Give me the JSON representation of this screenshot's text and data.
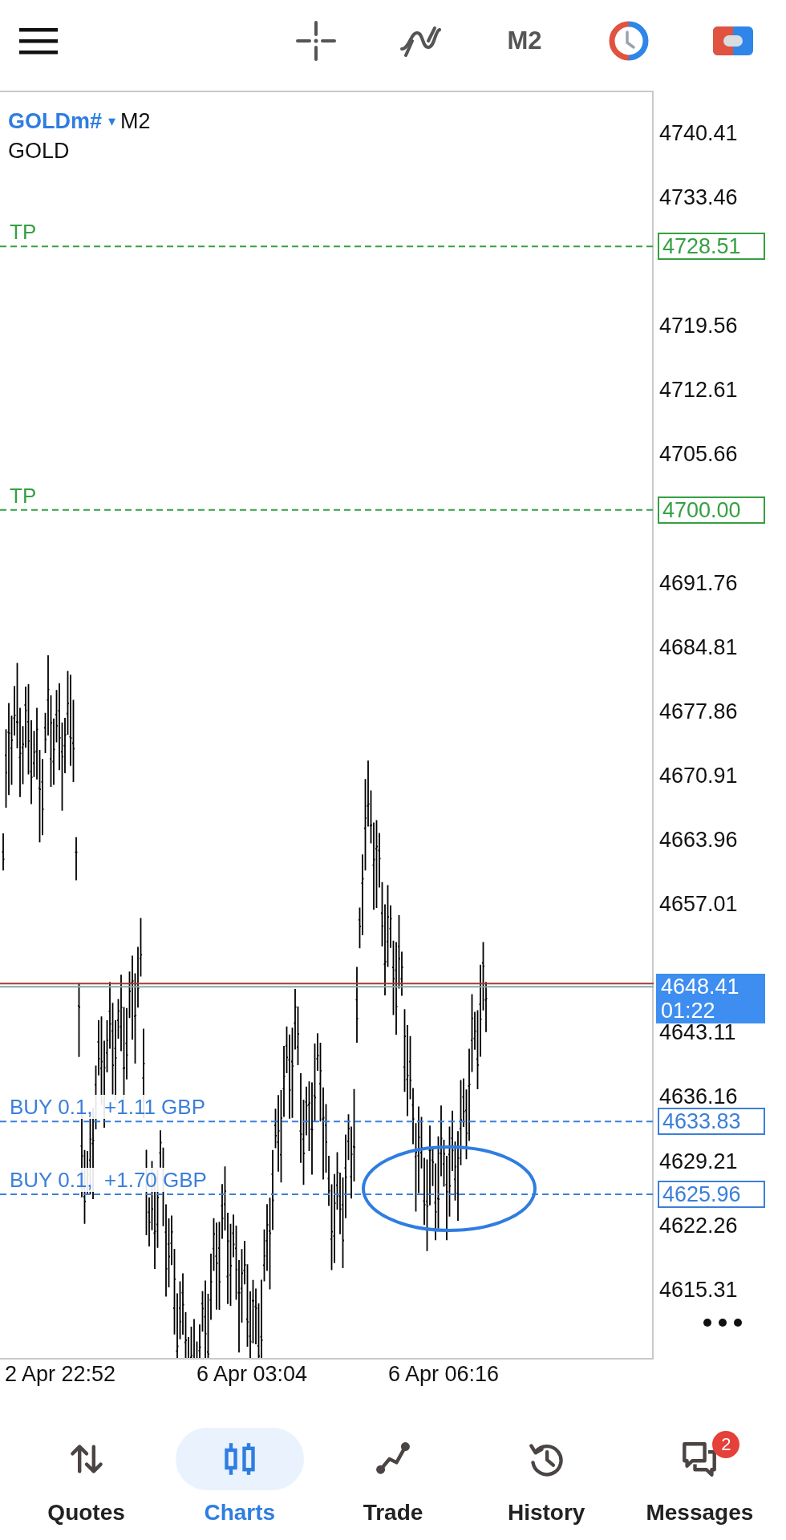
{
  "toolbar": {
    "timeframe": "M2"
  },
  "chart": {
    "symbol": "GOLDm#",
    "dropdown": "▾",
    "timeframe": "M2",
    "description": "GOLD",
    "levels": [
      {
        "kind": "tp",
        "label": "TP",
        "price": "4728.51"
      },
      {
        "kind": "tp",
        "label": "TP",
        "price": "4700.00"
      },
      {
        "kind": "position",
        "label": "BUY 0.1,  +1.11 GBP",
        "price": "4633.83"
      },
      {
        "kind": "position",
        "label": "BUY 0.1,  +1.70 GBP",
        "price": "4625.96"
      }
    ],
    "bid": {
      "price": "4648.41",
      "timer": "01:22"
    },
    "price_axis": [
      "4740.41",
      "4733.46",
      "4719.56",
      "4712.61",
      "4705.66",
      "4691.76",
      "4684.81",
      "4677.86",
      "4670.91",
      "4663.96",
      "4657.01",
      "4643.11",
      "4636.16",
      "4629.21",
      "4622.26",
      "4615.31"
    ],
    "time_axis": [
      "2 Apr 22:52",
      "6 Apr 03:04",
      "6 Apr 06:16"
    ]
  },
  "nav": [
    {
      "kind": "quotes",
      "label": "Quotes",
      "selected": false
    },
    {
      "kind": "charts",
      "label": "Charts",
      "selected": true
    },
    {
      "kind": "trade",
      "label": "Trade",
      "selected": false
    },
    {
      "kind": "history",
      "label": "History",
      "selected": false
    },
    {
      "kind": "messages",
      "label": "Messages",
      "selected": false,
      "badge": "2"
    }
  ]
}
